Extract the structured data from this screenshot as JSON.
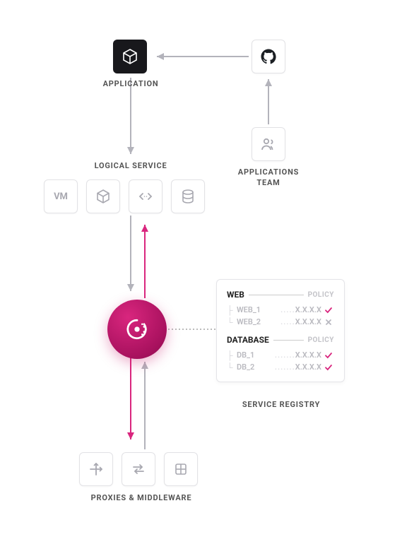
{
  "labels": {
    "application": "APPLICATION",
    "applications_team": "APPLICATIONS TEAM",
    "logical_service": "LOGICAL SERVICE",
    "service_registry": "SERVICE REGISTRY",
    "proxies_middleware": "PROXIES & MIDDLEWARE",
    "vm": "VM",
    "policy": "POLICY"
  },
  "icons": {
    "app_box": "cube",
    "github": "github-logo",
    "team": "users",
    "vm": "vm-text",
    "container": "cube",
    "code": "code-brackets",
    "database": "database",
    "consul": "consul-logo",
    "proxy1": "arrows-cross",
    "proxy2": "arrows-swap",
    "proxy3": "server-grid"
  },
  "registry": {
    "sections": [
      {
        "title": "WEB",
        "entries": [
          {
            "name": "WEB_1",
            "addr": "X.X.X.X",
            "status": "ok"
          },
          {
            "name": "WEB_2",
            "addr": "X.X.X.X",
            "status": "fail"
          }
        ]
      },
      {
        "title": "DATABASE",
        "entries": [
          {
            "name": "DB_1",
            "addr": "X.X.X.X",
            "status": "ok"
          },
          {
            "name": "DB_2",
            "addr": "X.X.X.X",
            "status": "ok"
          }
        ]
      }
    ]
  },
  "colors": {
    "accent": "#d9267e",
    "grey": "#b3b3bb"
  }
}
